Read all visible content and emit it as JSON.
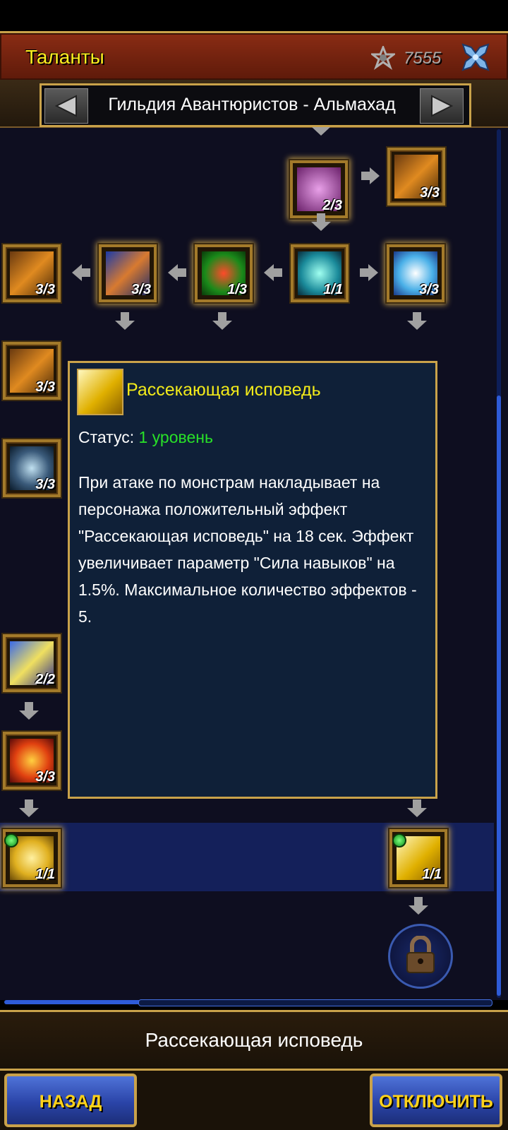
{
  "header": {
    "title": "Таланты",
    "currency_icon": "talent-point-icon",
    "currency_value": "7555",
    "close_icon": "close-icon"
  },
  "guild_selector": {
    "name": "Гильдия Авантюристов - Альмахад"
  },
  "talents": [
    {
      "id": "t1",
      "level": "2/3",
      "icon": "emblem-icon"
    },
    {
      "id": "t2",
      "level": "3/3",
      "icon": "griffin-icon"
    },
    {
      "id": "t3",
      "level": "3/3",
      "icon": "griffin-icon"
    },
    {
      "id": "t4",
      "level": "3/3",
      "icon": "warrior-icon"
    },
    {
      "id": "t5",
      "level": "1/3",
      "icon": "vortex-icon"
    },
    {
      "id": "t6",
      "level": "1/1",
      "icon": "spirit-icon"
    },
    {
      "id": "t7",
      "level": "3/3",
      "icon": "wing-emblem-icon"
    },
    {
      "id": "t8",
      "level": "3/3",
      "icon": "griffin-icon"
    },
    {
      "id": "t9",
      "level": "3/3",
      "icon": "skull-icon"
    },
    {
      "id": "t10",
      "level": "2/2",
      "icon": "light-beam-icon"
    },
    {
      "id": "t11",
      "level": "3/3",
      "icon": "fire-dragon-icon"
    },
    {
      "id": "t12",
      "level": "1/1",
      "icon": "hand-icon"
    },
    {
      "id": "t13",
      "level": "1/1",
      "icon": "blade-icon"
    }
  ],
  "tooltip": {
    "title": "Рассекающая исповедь",
    "status_label": "Статус:",
    "status_value": "1 уровень",
    "description": "При атаке по монстрам накладывает на персонажа положительный эффект \"Рассекающая исповедь\" на 18 сек. Эффект увеличивает параметр \"Сила навыков\" на 1.5%. Максимальное количество эффектов - 5."
  },
  "selected_talent": "Рассекающая исповедь",
  "buttons": {
    "back": "НАЗАД",
    "disable": "ОТКЛЮЧИТЬ"
  },
  "colors": {
    "title_yellow": "#ffee20",
    "status_green": "#28e028",
    "gold_border": "#c9a24a",
    "button_blue": "#3a5ac8"
  }
}
